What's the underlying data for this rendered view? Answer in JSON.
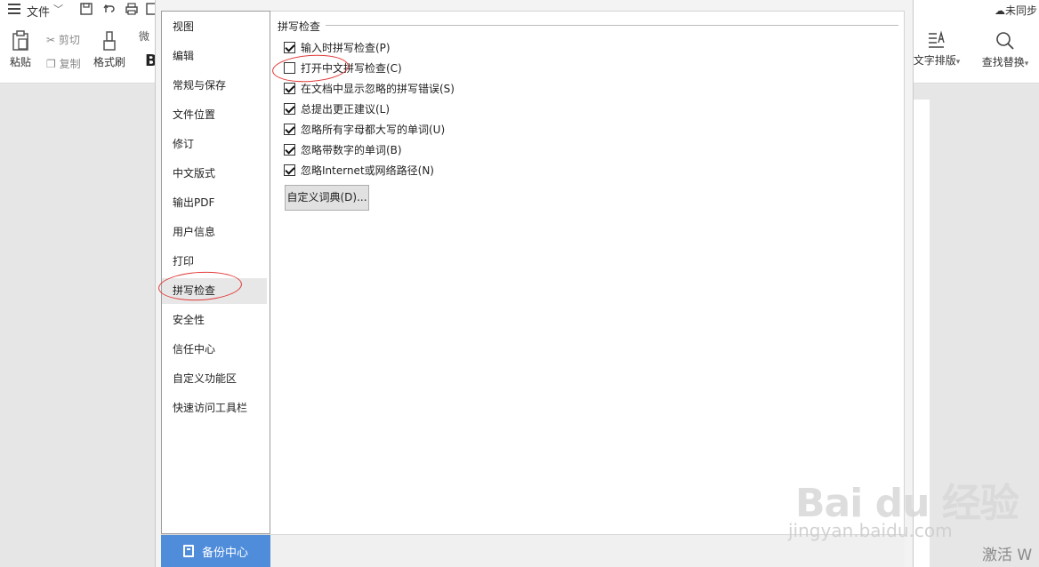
{
  "app": {
    "file_menu": "文件",
    "sync_status": "未同步",
    "ribbon": {
      "paste": "粘贴",
      "cut": "剪切",
      "copy": "复制",
      "format_painter": "格式刷",
      "font_name_partial": "微",
      "bold_glyph": "B",
      "text_layout": "文字排版",
      "find_replace": "查找替换"
    }
  },
  "dialog": {
    "nav": [
      {
        "id": "view",
        "label": "视图"
      },
      {
        "id": "edit",
        "label": "编辑"
      },
      {
        "id": "general-save",
        "label": "常规与保存"
      },
      {
        "id": "file-location",
        "label": "文件位置"
      },
      {
        "id": "revision",
        "label": "修订"
      },
      {
        "id": "chinese-layout",
        "label": "中文版式"
      },
      {
        "id": "export-pdf",
        "label": "输出PDF"
      },
      {
        "id": "user-info",
        "label": "用户信息"
      },
      {
        "id": "print",
        "label": "打印"
      },
      {
        "id": "spell-check",
        "label": "拼写检查",
        "active": true
      },
      {
        "id": "security",
        "label": "安全性"
      },
      {
        "id": "trust-center",
        "label": "信任中心"
      },
      {
        "id": "custom-ribbon",
        "label": "自定义功能区"
      },
      {
        "id": "quick-access",
        "label": "快速访问工具栏"
      }
    ],
    "section_title": "拼写检查",
    "options": [
      {
        "label": "输入时拼写检查(P)",
        "checked": true
      },
      {
        "label": "打开中文拼写检查(C)",
        "checked": false
      },
      {
        "label": "在文档中显示忽略的拼写错误(S)",
        "checked": true
      },
      {
        "label": "总提出更正建议(L)",
        "checked": true
      },
      {
        "label": "忽略所有字母都大写的单词(U)",
        "checked": true
      },
      {
        "label": "忽略带数字的单词(B)",
        "checked": true
      },
      {
        "label": "忽略Internet或网络路径(N)",
        "checked": true
      }
    ],
    "custom_dict_button": "自定义词典(D)...",
    "backup_center": "备份中心"
  },
  "watermark": {
    "brand": "Bai du 经验",
    "url": "jingyan.baidu.com",
    "activate": "激活 W"
  },
  "colors": {
    "backup_button": "#4f8ddb",
    "annotation_ring": "#e23a3a",
    "active_nav": "#e7e7e7"
  }
}
